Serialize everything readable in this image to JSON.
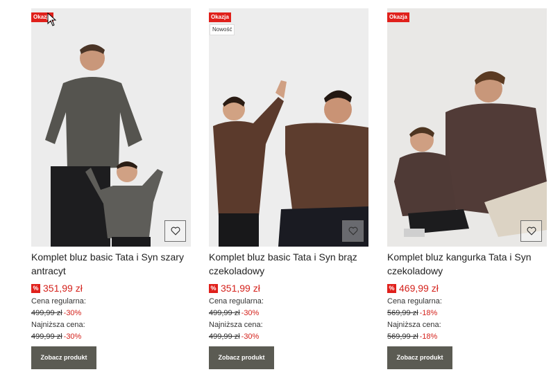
{
  "products": [
    {
      "badge": "Okazja",
      "title": "Komplet bluz basic Tata i Syn szary antracyt",
      "sale_icon": "%",
      "price": "351,99 zł",
      "regular_label": "Cena regularna:",
      "regular_old": "499,99 zł",
      "regular_pct": "-30%",
      "lowest_label": "Najniższa cena:",
      "lowest_old": "499,99 zł",
      "lowest_pct": "-30%",
      "button": "Zobacz produkt",
      "wishlist_icon": "heart-icon"
    },
    {
      "badge": "Okazja",
      "badge_new": "Nowość",
      "title": "Komplet bluz basic Tata i Syn brąz czekoladowy",
      "sale_icon": "%",
      "price": "351,99 zł",
      "regular_label": "Cena regularna:",
      "regular_old": "499,99 zł",
      "regular_pct": "-30%",
      "lowest_label": "Najniższa cena:",
      "lowest_old": "499,99 zł",
      "lowest_pct": "-30%",
      "button": "Zobacz produkt",
      "wishlist_icon": "heart-icon"
    },
    {
      "badge": "Okazja",
      "title": "Komplet bluz kangurka Tata i Syn czekoladowy",
      "sale_icon": "%",
      "price": "469,99 zł",
      "regular_label": "Cena regularna:",
      "regular_old": "569,99 zł",
      "regular_pct": "-18%",
      "lowest_label": "Najniższa cena:",
      "lowest_old": "569,99 zł",
      "lowest_pct": "-18%",
      "button": "Zobacz produkt",
      "wishlist_icon": "heart-icon"
    }
  ],
  "colors": {
    "sale_red": "#e0201b",
    "price_red": "#d4211b",
    "button_bg": "#5b5b53"
  }
}
